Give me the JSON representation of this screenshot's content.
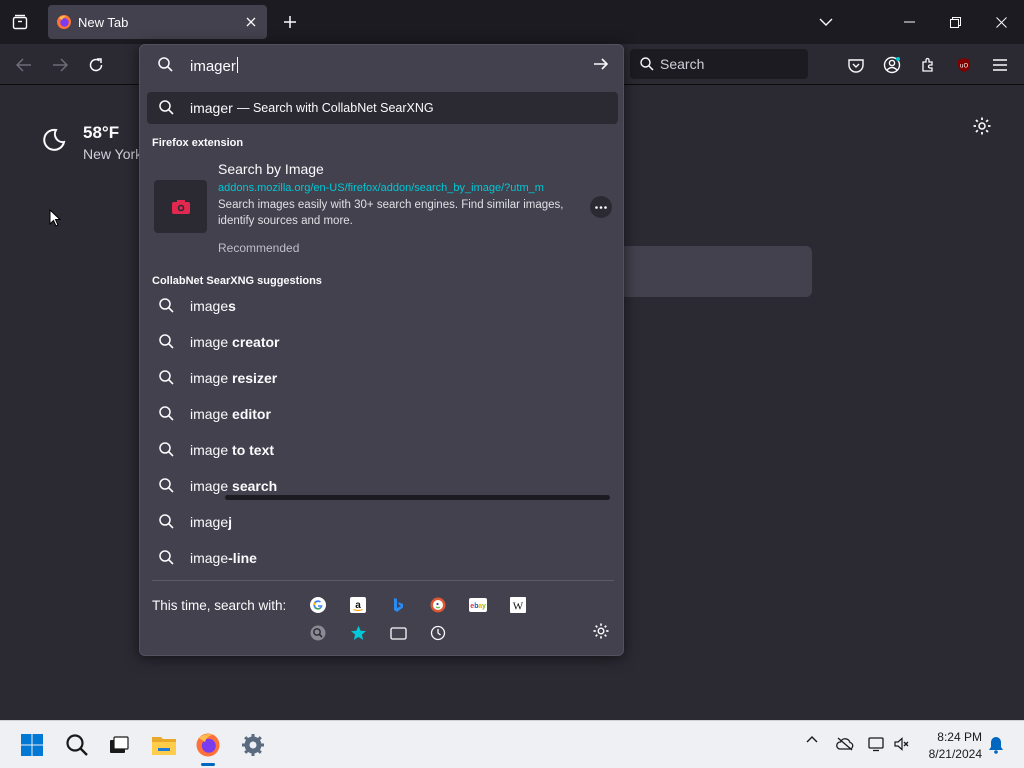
{
  "browser": {
    "tab": {
      "title": "New Tab"
    },
    "search_placeholder": "Search"
  },
  "page": {
    "weather": {
      "temp": "58°F",
      "location": "New York"
    }
  },
  "urlbar": {
    "input_value": "imager",
    "heuristic": {
      "query": "imager",
      "action": "—  Search with CollabNet SearXNG"
    },
    "extension_group_label": "Firefox extension",
    "extension": {
      "title": "Search by Image",
      "url": "addons.mozilla.org/en-US/firefox/addon/search_by_image/?utm_m",
      "description": "Search images easily with 30+ search engines. Find similar images, identify sources and more.",
      "recommended": "Recommended"
    },
    "suggestions_group_label": "CollabNet SearXNG suggestions",
    "suggestions": [
      {
        "typed": "image",
        "completion": "s"
      },
      {
        "typed": "image ",
        "completion": "creator"
      },
      {
        "typed": "image ",
        "completion": "resizer"
      },
      {
        "typed": "image ",
        "completion": "editor"
      },
      {
        "typed": "image ",
        "completion": "to text"
      },
      {
        "typed": "image ",
        "completion": "search"
      },
      {
        "typed": "image",
        "completion": "j"
      },
      {
        "typed": "image",
        "completion": "-line"
      }
    ],
    "one_off_label": "This time, search with:",
    "one_off_engines": [
      "google-icon",
      "amazon-icon",
      "bing-icon",
      "duckduckgo-icon",
      "ebay-icon",
      "wikipedia-icon",
      "searxng-icon",
      "bookmarks-icon",
      "tabs-icon",
      "history-icon"
    ]
  },
  "taskbar": {
    "time": "8:24 PM",
    "date": "8/21/2024"
  },
  "colors": {
    "accent_cyan": "#00c8d7",
    "panel": "#42414d",
    "toolbar": "#2b2a33",
    "tabstrip": "#1c1b22",
    "windows_blue": "#0067c0"
  }
}
